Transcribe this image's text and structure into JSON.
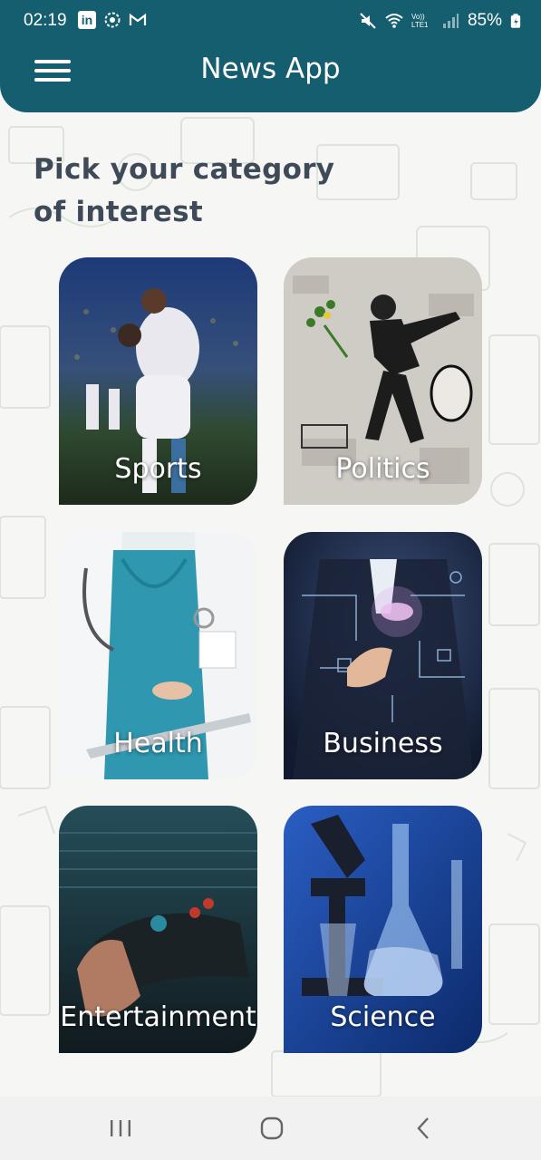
{
  "status_bar": {
    "time": "02:19",
    "battery": "85%",
    "left_icons": [
      "linkedin-icon",
      "sync-icon",
      "gmail-icon"
    ],
    "right_icons": [
      "mute-icon",
      "wifi-icon",
      "volte-icon",
      "signal-icon",
      "battery-icon"
    ],
    "volte_text": "Vo)) LTE1"
  },
  "header": {
    "title": "News App",
    "bg_color": "#155e70"
  },
  "heading": {
    "line1": "Pick your category",
    "line2": "of interest"
  },
  "categories": [
    {
      "label": "Sports"
    },
    {
      "label": "Politics"
    },
    {
      "label": "Health"
    },
    {
      "label": "Business"
    },
    {
      "label": "Entertainment"
    },
    {
      "label": "Science"
    }
  ],
  "nav_bar": {
    "buttons": [
      "recent-apps-icon",
      "home-icon",
      "back-icon"
    ]
  }
}
